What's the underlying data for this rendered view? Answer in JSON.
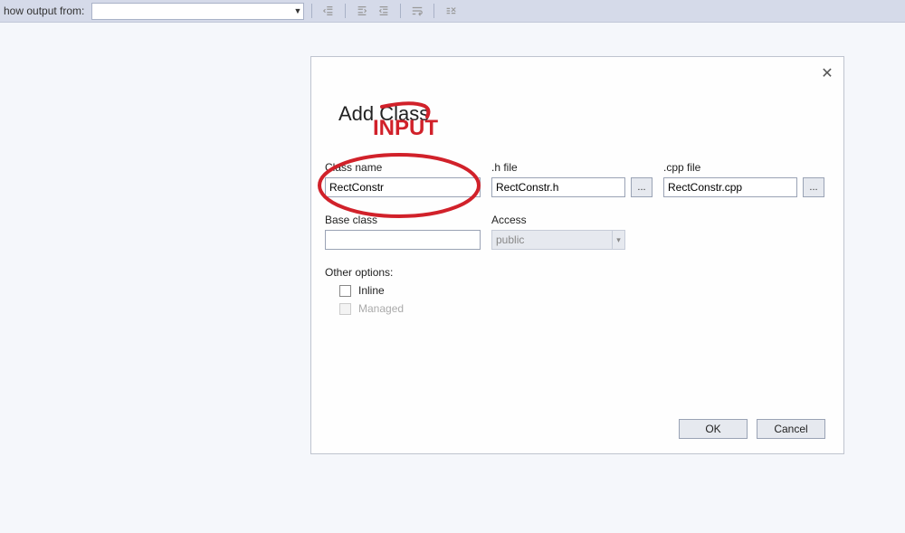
{
  "toolbar": {
    "label": "how output from:",
    "selected": ""
  },
  "dialog": {
    "title": "Add Class",
    "annotation": "INPUT",
    "class_name": {
      "label": "Class name",
      "value": "RectConstr"
    },
    "h_file": {
      "label": ".h file",
      "value": "RectConstr.h",
      "browse": "..."
    },
    "cpp_file": {
      "label": ".cpp file",
      "value": "RectConstr.cpp",
      "browse": "..."
    },
    "base_class": {
      "label": "Base class",
      "value": ""
    },
    "access": {
      "label": "Access",
      "value": "public"
    },
    "other_options": {
      "label": "Other options:",
      "inline": {
        "label": "Inline",
        "checked": false
      },
      "managed": {
        "label": "Managed",
        "checked": false,
        "disabled": true
      }
    },
    "buttons": {
      "ok": "OK",
      "cancel": "Cancel"
    }
  }
}
